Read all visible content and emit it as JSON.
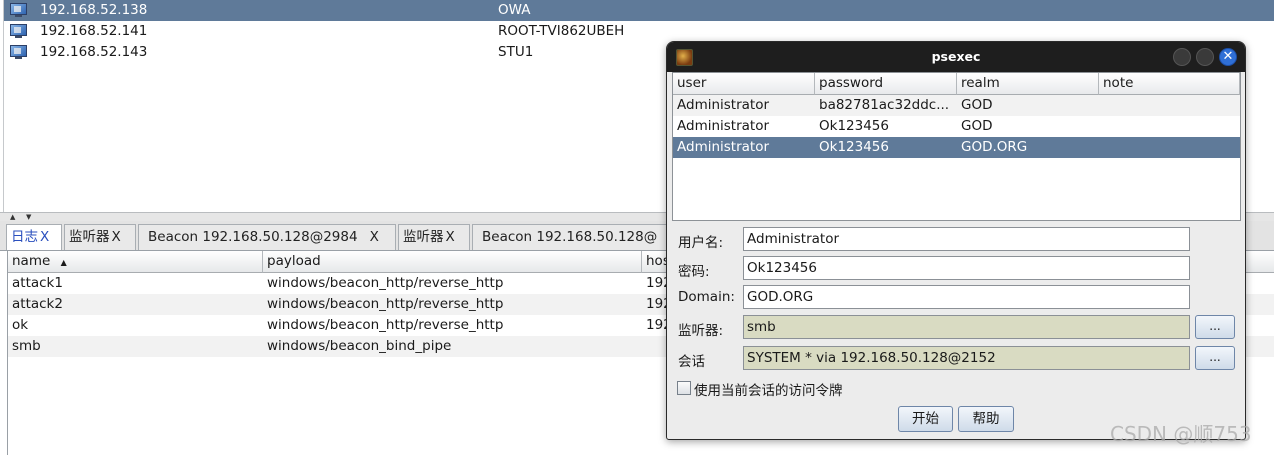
{
  "hosts": [
    {
      "ip": "192.168.52.138",
      "name": "OWA",
      "selected": true
    },
    {
      "ip": "192.168.52.141",
      "name": "ROOT-TVI862UBEH",
      "selected": false
    },
    {
      "ip": "192.168.52.143",
      "name": "STU1",
      "selected": false
    }
  ],
  "splitter": {
    "up": "▲",
    "down": "▼"
  },
  "tabs": [
    {
      "label": "日志",
      "close": "X"
    },
    {
      "label": "监听器",
      "close": "X"
    },
    {
      "label": "Beacon 192.168.50.128@2984",
      "close": "X"
    },
    {
      "label": "监听器",
      "close": "X"
    },
    {
      "label": "Beacon 192.168.50.128@"
    }
  ],
  "listeners": {
    "headers": {
      "name": "name",
      "sort": "▲",
      "payload": "payload",
      "host": "hos"
    },
    "rows": [
      {
        "name": "attack1",
        "payload": "windows/beacon_http/reverse_http",
        "host": "192"
      },
      {
        "name": "attack2",
        "payload": "windows/beacon_http/reverse_http",
        "host": "192"
      },
      {
        "name": "ok",
        "payload": "windows/beacon_http/reverse_http",
        "host": "192"
      },
      {
        "name": "smb",
        "payload": "windows/beacon_bind_pipe",
        "host": ""
      }
    ]
  },
  "dialog": {
    "title": "psexec",
    "close_glyph": "✕",
    "cred_headers": {
      "user": "user",
      "password": "password",
      "realm": "realm",
      "note": "note"
    },
    "creds": [
      {
        "user": "Administrator",
        "password": "ba82781ac32ddc...",
        "realm": "GOD",
        "note": ""
      },
      {
        "user": "Administrator",
        "password": "Ok123456",
        "realm": "GOD",
        "note": ""
      },
      {
        "user": "Administrator",
        "password": "Ok123456",
        "realm": "GOD.ORG",
        "note": ""
      }
    ],
    "form": {
      "username_label": "用户名:",
      "username": "Administrator",
      "password_label": "密码:",
      "password": "Ok123456",
      "domain_label": "Domain:",
      "domain": "GOD.ORG",
      "listener_label": "监听器:",
      "listener": "smb",
      "session_label": "会话",
      "session": "SYSTEM * via  192.168.50.128@2152",
      "browse": "...",
      "token_checkbox": "使用当前会话的访问令牌"
    },
    "buttons": {
      "start": "开始",
      "help": "帮助"
    }
  },
  "watermark": "CSDN @顺753",
  "colors": {
    "selection": "#5f7a99",
    "titlebar": "#1e1e1e",
    "readonly_field": "#d9dbc2",
    "active_tab": "#2a4fbe"
  }
}
